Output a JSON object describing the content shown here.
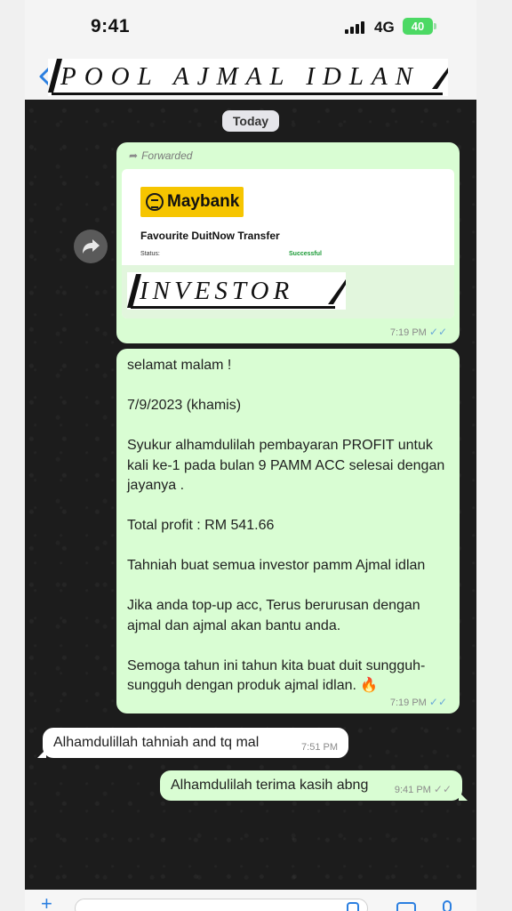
{
  "status_bar": {
    "time": "9:41",
    "network": "4G",
    "battery": "40"
  },
  "header": {
    "contact_name": "POOL AJMAL IDLAN",
    "back_icon": "chevron-left-icon"
  },
  "chat": {
    "date_label": "Today",
    "forwarded_message": {
      "forwarded_label": "Forwarded",
      "bank_name": "Maybank",
      "receipt_title": "Favourite DuitNow Transfer",
      "status_label": "Status:",
      "status_value": "Successful",
      "overlay_text": "INVESTOR",
      "time": "7:19 PM"
    },
    "text_message": {
      "body": "selamat malam !\n\n7/9/2023 (khamis)\n\nSyukur alhamdulilah pembayaran PROFIT untuk kali ke-1 pada bulan 9 PAMM ACC selesai dengan jayanya .\n\nTotal profit : RM 541.66\n\nTahniah buat semua investor pamm Ajmal idlan\n\nJika anda top-up acc, Terus berurusan dengan ajmal dan ajmal akan bantu anda.\n\nSemoga tahun ini tahun kita buat duit sungguh-sungguh dengan produk ajmal idlan. 🔥",
      "time": "7:19 PM"
    },
    "incoming_reply": {
      "text": "Alhamdulillah tahniah and tq mal",
      "time": "7:51 PM"
    },
    "outgoing_reply": {
      "text": "Alhamdulilah terima kasih abng",
      "time": "9:41 PM"
    }
  },
  "input_bar": {
    "placeholder": "",
    "icons": [
      "plus-icon",
      "sticker-icon",
      "camera-icon",
      "mic-icon"
    ]
  },
  "colors": {
    "outgoing_bubble": "#d9fdd3",
    "incoming_bubble": "#ffffff",
    "read_ticks": "#6aa9d9",
    "maybank_yellow": "#f6c500"
  }
}
